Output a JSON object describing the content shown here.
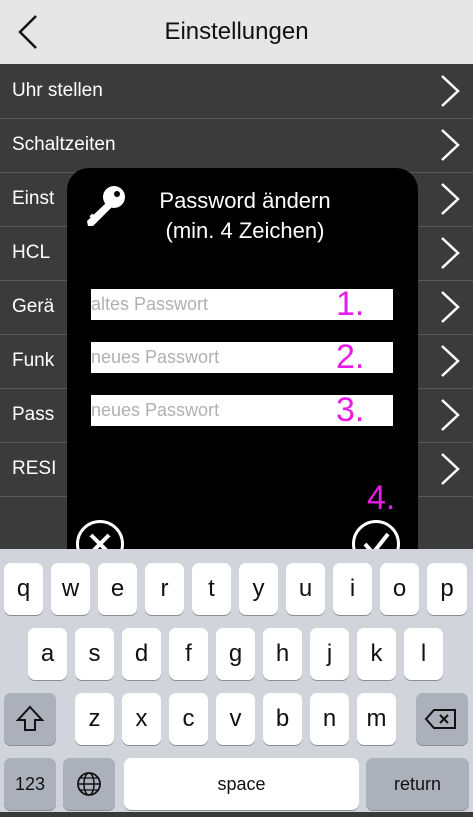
{
  "nav": {
    "title": "Einstellungen"
  },
  "list": {
    "items": [
      {
        "label": "Uhr stellen"
      },
      {
        "label": "Schaltzeiten"
      },
      {
        "label": "Einst"
      },
      {
        "label": "HCL"
      },
      {
        "label": "Gerä"
      },
      {
        "label": "Funk"
      },
      {
        "label": "Pass"
      },
      {
        "label": "RESI"
      }
    ]
  },
  "dialog": {
    "title_line1": "Password ändern",
    "title_line2": "(min. 4 Zeichen)",
    "fields": [
      {
        "placeholder": "altes Passwort",
        "step": "1."
      },
      {
        "placeholder": "neues Passwort",
        "step": "2."
      },
      {
        "placeholder": "neues Passwort",
        "step": "3."
      }
    ],
    "confirm_step": "4."
  },
  "keyboard": {
    "row1": [
      "q",
      "w",
      "e",
      "r",
      "t",
      "y",
      "u",
      "i",
      "o",
      "p"
    ],
    "row2": [
      "a",
      "s",
      "d",
      "f",
      "g",
      "h",
      "j",
      "k",
      "l"
    ],
    "row3": [
      "z",
      "x",
      "c",
      "v",
      "b",
      "n",
      "m"
    ],
    "numbers_label": "123",
    "space_label": "space",
    "return_label": "return"
  },
  "colors": {
    "accent_step": "#e81ce8",
    "list_bg": "#3b3b3b",
    "dialog_bg": "#000000"
  }
}
